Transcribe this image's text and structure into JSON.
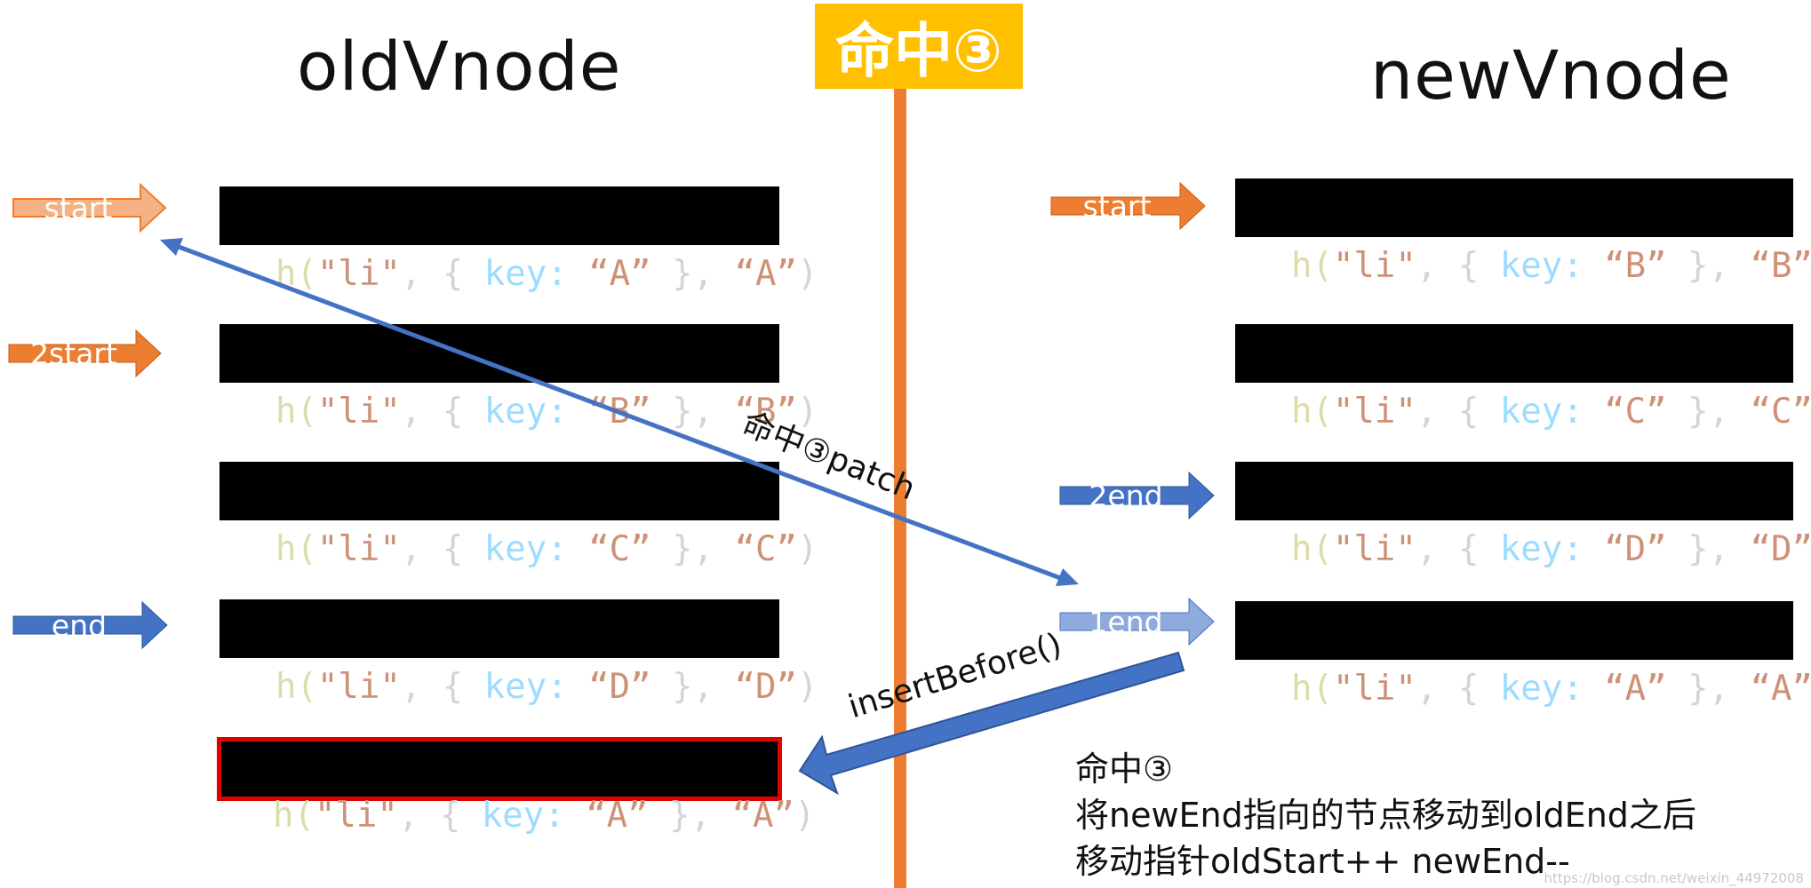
{
  "old_title": "oldVnode",
  "new_title": "newVnode",
  "badge": "命中③",
  "code": {
    "prefix": "h(",
    "tag": "\"li\"",
    "mid1": ", { ",
    "key_word": "key:",
    "mid2": " }, ",
    "suffix": ")"
  },
  "old_nodes": [
    {
      "key": "“A”",
      "text": "“A”"
    },
    {
      "key": "“B”",
      "text": "“B”"
    },
    {
      "key": "“C”",
      "text": "“C”"
    },
    {
      "key": "“D”",
      "text": "“D”"
    },
    {
      "key": "“A”",
      "text": "“A”"
    }
  ],
  "new_nodes": [
    {
      "key": "“B”",
      "text": "“B”"
    },
    {
      "key": "“C”",
      "text": "“C”"
    },
    {
      "key": "“D”",
      "text": "“D”"
    },
    {
      "key": "“A”",
      "text": "“A”"
    }
  ],
  "pointers": {
    "old_start": "start",
    "old_2start": "2start",
    "old_end": "end",
    "new_start": "start",
    "new_2end": "2end",
    "new_1end": "1end"
  },
  "arrow_labels": {
    "patch": "命中③patch",
    "insert": "insertBefore()"
  },
  "note_lines": [
    "命中③",
    "将newEnd指向的节点移动到oldEnd之后",
    "移动指针oldStart++ newEnd--"
  ],
  "watermark": "https://blog.csdn.net/weixin_44972008",
  "colors": {
    "orange": "#ed7d31",
    "light_orange": "#f4b183",
    "blue": "#4472c4",
    "light_blue": "#8faadc",
    "yellow": "#ffc000",
    "highlight_border": "#e00000"
  }
}
